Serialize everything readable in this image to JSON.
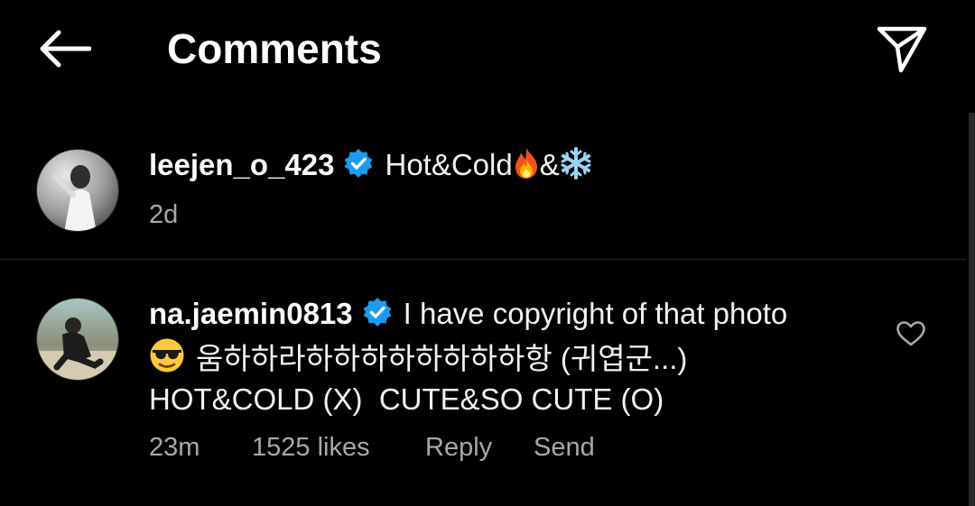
{
  "header": {
    "title": "Comments"
  },
  "comments": [
    {
      "username": "leejen_o_423",
      "verified": true,
      "text_prefix": "Hot&Cold",
      "text_middle": "&",
      "emojis": [
        "fire-icon",
        "snowflake-icon"
      ],
      "time": "2d"
    },
    {
      "username": "na.jaemin0813",
      "verified": true,
      "line1": "I have copyright of that photo",
      "line2": "움하하라하하하하하하하하항 (귀엽군...)",
      "line3": "HOT&COLD (X)  CUTE&SO CUTE (O)",
      "emoji": "sunglasses-face-icon",
      "time": "23m",
      "likes": "1525 likes",
      "reply_label": "Reply",
      "send_label": "Send"
    }
  ],
  "colors": {
    "background": "#000000",
    "text": "#f5f5f5",
    "muted": "#a8a8a8",
    "verified_blue": "#1d9bf0",
    "divider": "#262626"
  }
}
